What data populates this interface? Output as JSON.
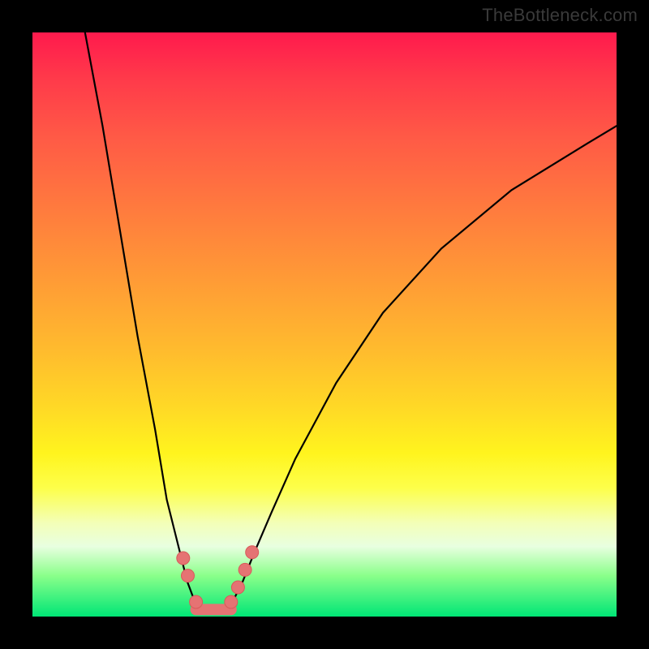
{
  "watermark": "TheBottleneck.com",
  "colors": {
    "background_frame": "#000000",
    "gradient_top": "#ff1a4d",
    "gradient_mid": "#ffd826",
    "gradient_bottom": "#00e676",
    "curve_stroke": "#000000",
    "marker_fill": "#e57373"
  },
  "chart_data": {
    "type": "line",
    "title": "",
    "xlabel": "",
    "ylabel": "",
    "xlim": [
      0,
      100
    ],
    "ylim": [
      0,
      100
    ],
    "grid": false,
    "legend": false,
    "note": "V-shaped bottleneck curve. Y = bottleneck severity (0 green = none, 100 red = severe). X = relative hardware balance; minimum around x≈30 where components are balanced. Values estimated from pixel positions; no axis ticks or numeric labels are rendered in the original image.",
    "series": [
      {
        "name": "left-branch",
        "x": [
          9,
          12,
          15,
          18,
          21,
          23,
          25,
          26.5,
          28
        ],
        "y": [
          100,
          84,
          66,
          48,
          32,
          20,
          12,
          6,
          2
        ]
      },
      {
        "name": "right-branch",
        "x": [
          34,
          36,
          38,
          41,
          45,
          52,
          60,
          70,
          82,
          95,
          100
        ],
        "y": [
          2,
          6,
          11,
          18,
          27,
          40,
          52,
          63,
          73,
          81,
          84
        ]
      }
    ],
    "markers": {
      "name": "highlighted-points",
      "x": [
        25.8,
        26.6,
        28.0,
        34.0,
        35.2,
        36.4,
        37.6
      ],
      "y": [
        10,
        7,
        2.5,
        2.5,
        5,
        8,
        11
      ]
    },
    "flat_segment": {
      "x": [
        28,
        34
      ],
      "y": [
        1.2,
        1.2
      ]
    }
  }
}
